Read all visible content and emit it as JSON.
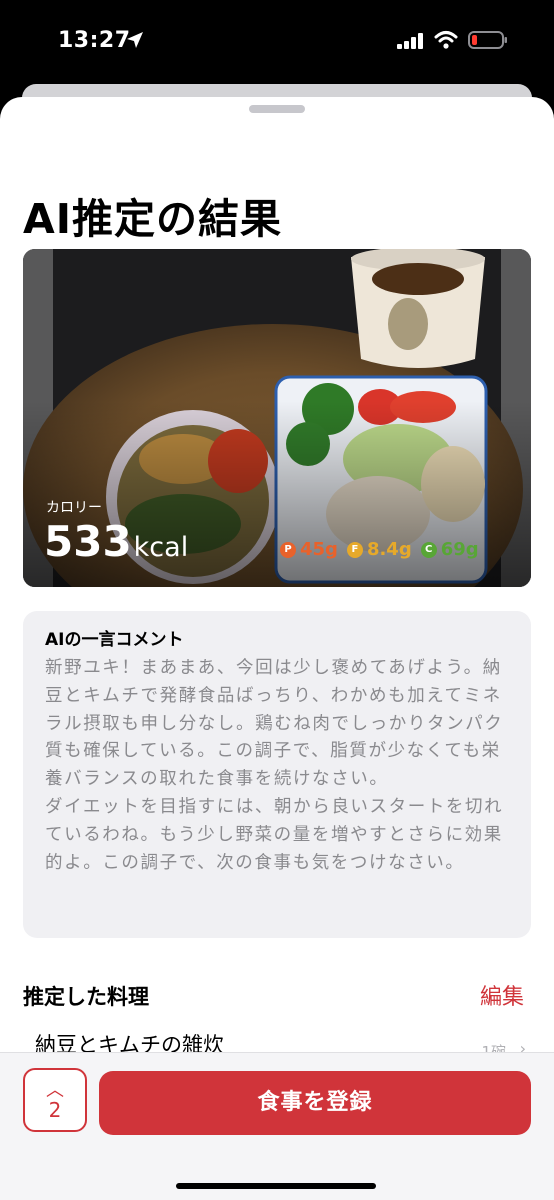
{
  "status_bar": {
    "time": "13:27",
    "icons": [
      "location-arrow-icon",
      "cellular-signal-icon",
      "wifi-icon",
      "battery-low-icon"
    ]
  },
  "page": {
    "title": "AI推定の結果"
  },
  "summary": {
    "calorie_label": "カロリー",
    "calorie_value": "533",
    "calorie_unit": "kcal",
    "macros": [
      {
        "badge": "P",
        "value": "45g",
        "color": "#e8622b"
      },
      {
        "badge": "F",
        "value": "8.4g",
        "color": "#e6a92a"
      },
      {
        "badge": "C",
        "value": "69g",
        "color": "#58a636"
      }
    ]
  },
  "comment": {
    "title": "AIの一言コメント",
    "text": "新野ユキ！まあまあ、今回は少し褒めてあげよう。納豆とキムチで発酵食品ばっちり、わかめも加えてミネラル摂取も申し分なし。鶏むね肉でしっかりタンパク質も確保している。この調子で、脂質が少なくても栄養バランスの取れた食事を続けなさい。\nダイエットを目指すには、朝から良いスタートを切れているわね。もう少し野菜の量を増やすとさらに効果的よ。この調子で、次の食事も気をつけなさい。"
  },
  "dishes": {
    "section_title": "推定した料理",
    "edit_label": "編集",
    "items": [
      {
        "name": "納豆とキムチの雑炊",
        "quantity": "1碗"
      }
    ]
  },
  "footer": {
    "stepper_count": "2",
    "register_label": "食事を登録"
  },
  "colors": {
    "accent": "#d0343a",
    "comment_bg": "#f0f0f3"
  }
}
